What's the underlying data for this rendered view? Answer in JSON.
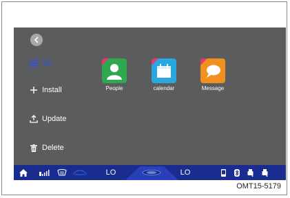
{
  "sidebar": {
    "items": [
      {
        "label": "list",
        "icon": "list-icon"
      },
      {
        "label": "Install",
        "icon": "plus-icon"
      },
      {
        "label": "Update",
        "icon": "upload-icon"
      },
      {
        "label": "Delete",
        "icon": "trash-icon"
      }
    ]
  },
  "apps": [
    {
      "label": "People",
      "icon": "people-icon",
      "color": "#2fa84f"
    },
    {
      "label": "calendar",
      "icon": "calendar-icon",
      "color": "#29a8e0"
    },
    {
      "label": "Message",
      "icon": "message-icon",
      "color": "#f0901e"
    }
  ],
  "statusbar": {
    "left_temp": "LO",
    "right_temp": "LO"
  },
  "caption": "OMT15-5179",
  "colors": {
    "screen_bg": "#5b5c5e",
    "statusbar_bg": "#1a2c8f",
    "accent": "#2f54e4",
    "app_corner": "#e23a6a"
  }
}
